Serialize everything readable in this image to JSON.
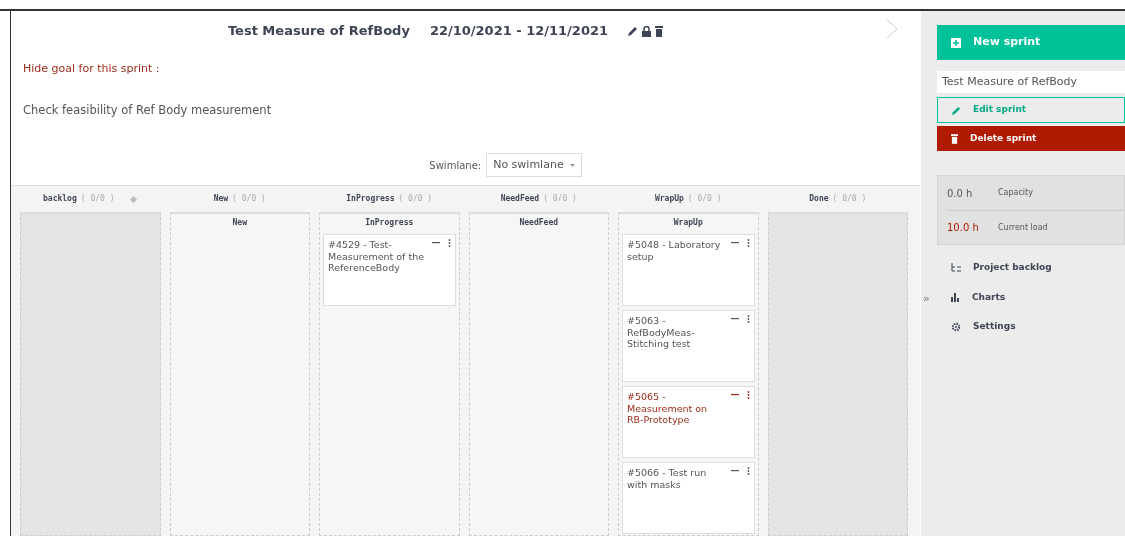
{
  "header": {
    "title": "Test Measure of RefBody",
    "dates": "22/10/2021 - 12/11/2021"
  },
  "goal": {
    "toggle": "Hide goal for this sprint :",
    "text": "Check feasibility of Ref Body measurement"
  },
  "swimlane": {
    "label": "Swimlane:",
    "value": "No swimlane"
  },
  "columns": [
    {
      "kind": "closed",
      "title": "backlog",
      "count": "( 0/0 )",
      "sortable": true
    },
    {
      "kind": "lane",
      "title": "New",
      "count": "( 0/0 )",
      "lane_title": "New"
    },
    {
      "kind": "lane",
      "title": "InProgress",
      "count": "( 0/0 )",
      "lane_title": "InProgress",
      "cards": [
        {
          "text": "#4529 - Test-Measurement of the ReferenceBody",
          "overdue": false
        }
      ]
    },
    {
      "kind": "lane",
      "title": "NeedFeed",
      "count": "( 0/0 )",
      "lane_title": "NeedFeed"
    },
    {
      "kind": "lane",
      "title": "WrapUp",
      "count": "( 0/0 )",
      "lane_title": "WrapUp",
      "cards": [
        {
          "text": "#5048 - Laboratory setup",
          "overdue": false
        },
        {
          "text": "#5063 - RefBodyMeas-Stitching test",
          "overdue": false
        },
        {
          "text": "#5065 - Measurement on RB-Prototype",
          "overdue": true
        },
        {
          "text": "#5066 - Test run with masks",
          "overdue": false
        }
      ]
    },
    {
      "kind": "closed",
      "title": "Done",
      "count": "( 0/0 )",
      "sortable": false
    }
  ],
  "expand": "»",
  "sidebar": {
    "new_sprint": "New sprint",
    "sprint_select": "Test Measure of RefBody",
    "edit": "Edit sprint",
    "delete": "Delete sprint",
    "stats": [
      {
        "value": "0.0 h",
        "label": "Capacity",
        "over": false
      },
      {
        "value": "10.0 h",
        "label": "Current load",
        "over": true
      }
    ],
    "nav": [
      {
        "label": "Project backlog"
      },
      {
        "label": "Charts"
      },
      {
        "label": "Settings"
      }
    ]
  }
}
